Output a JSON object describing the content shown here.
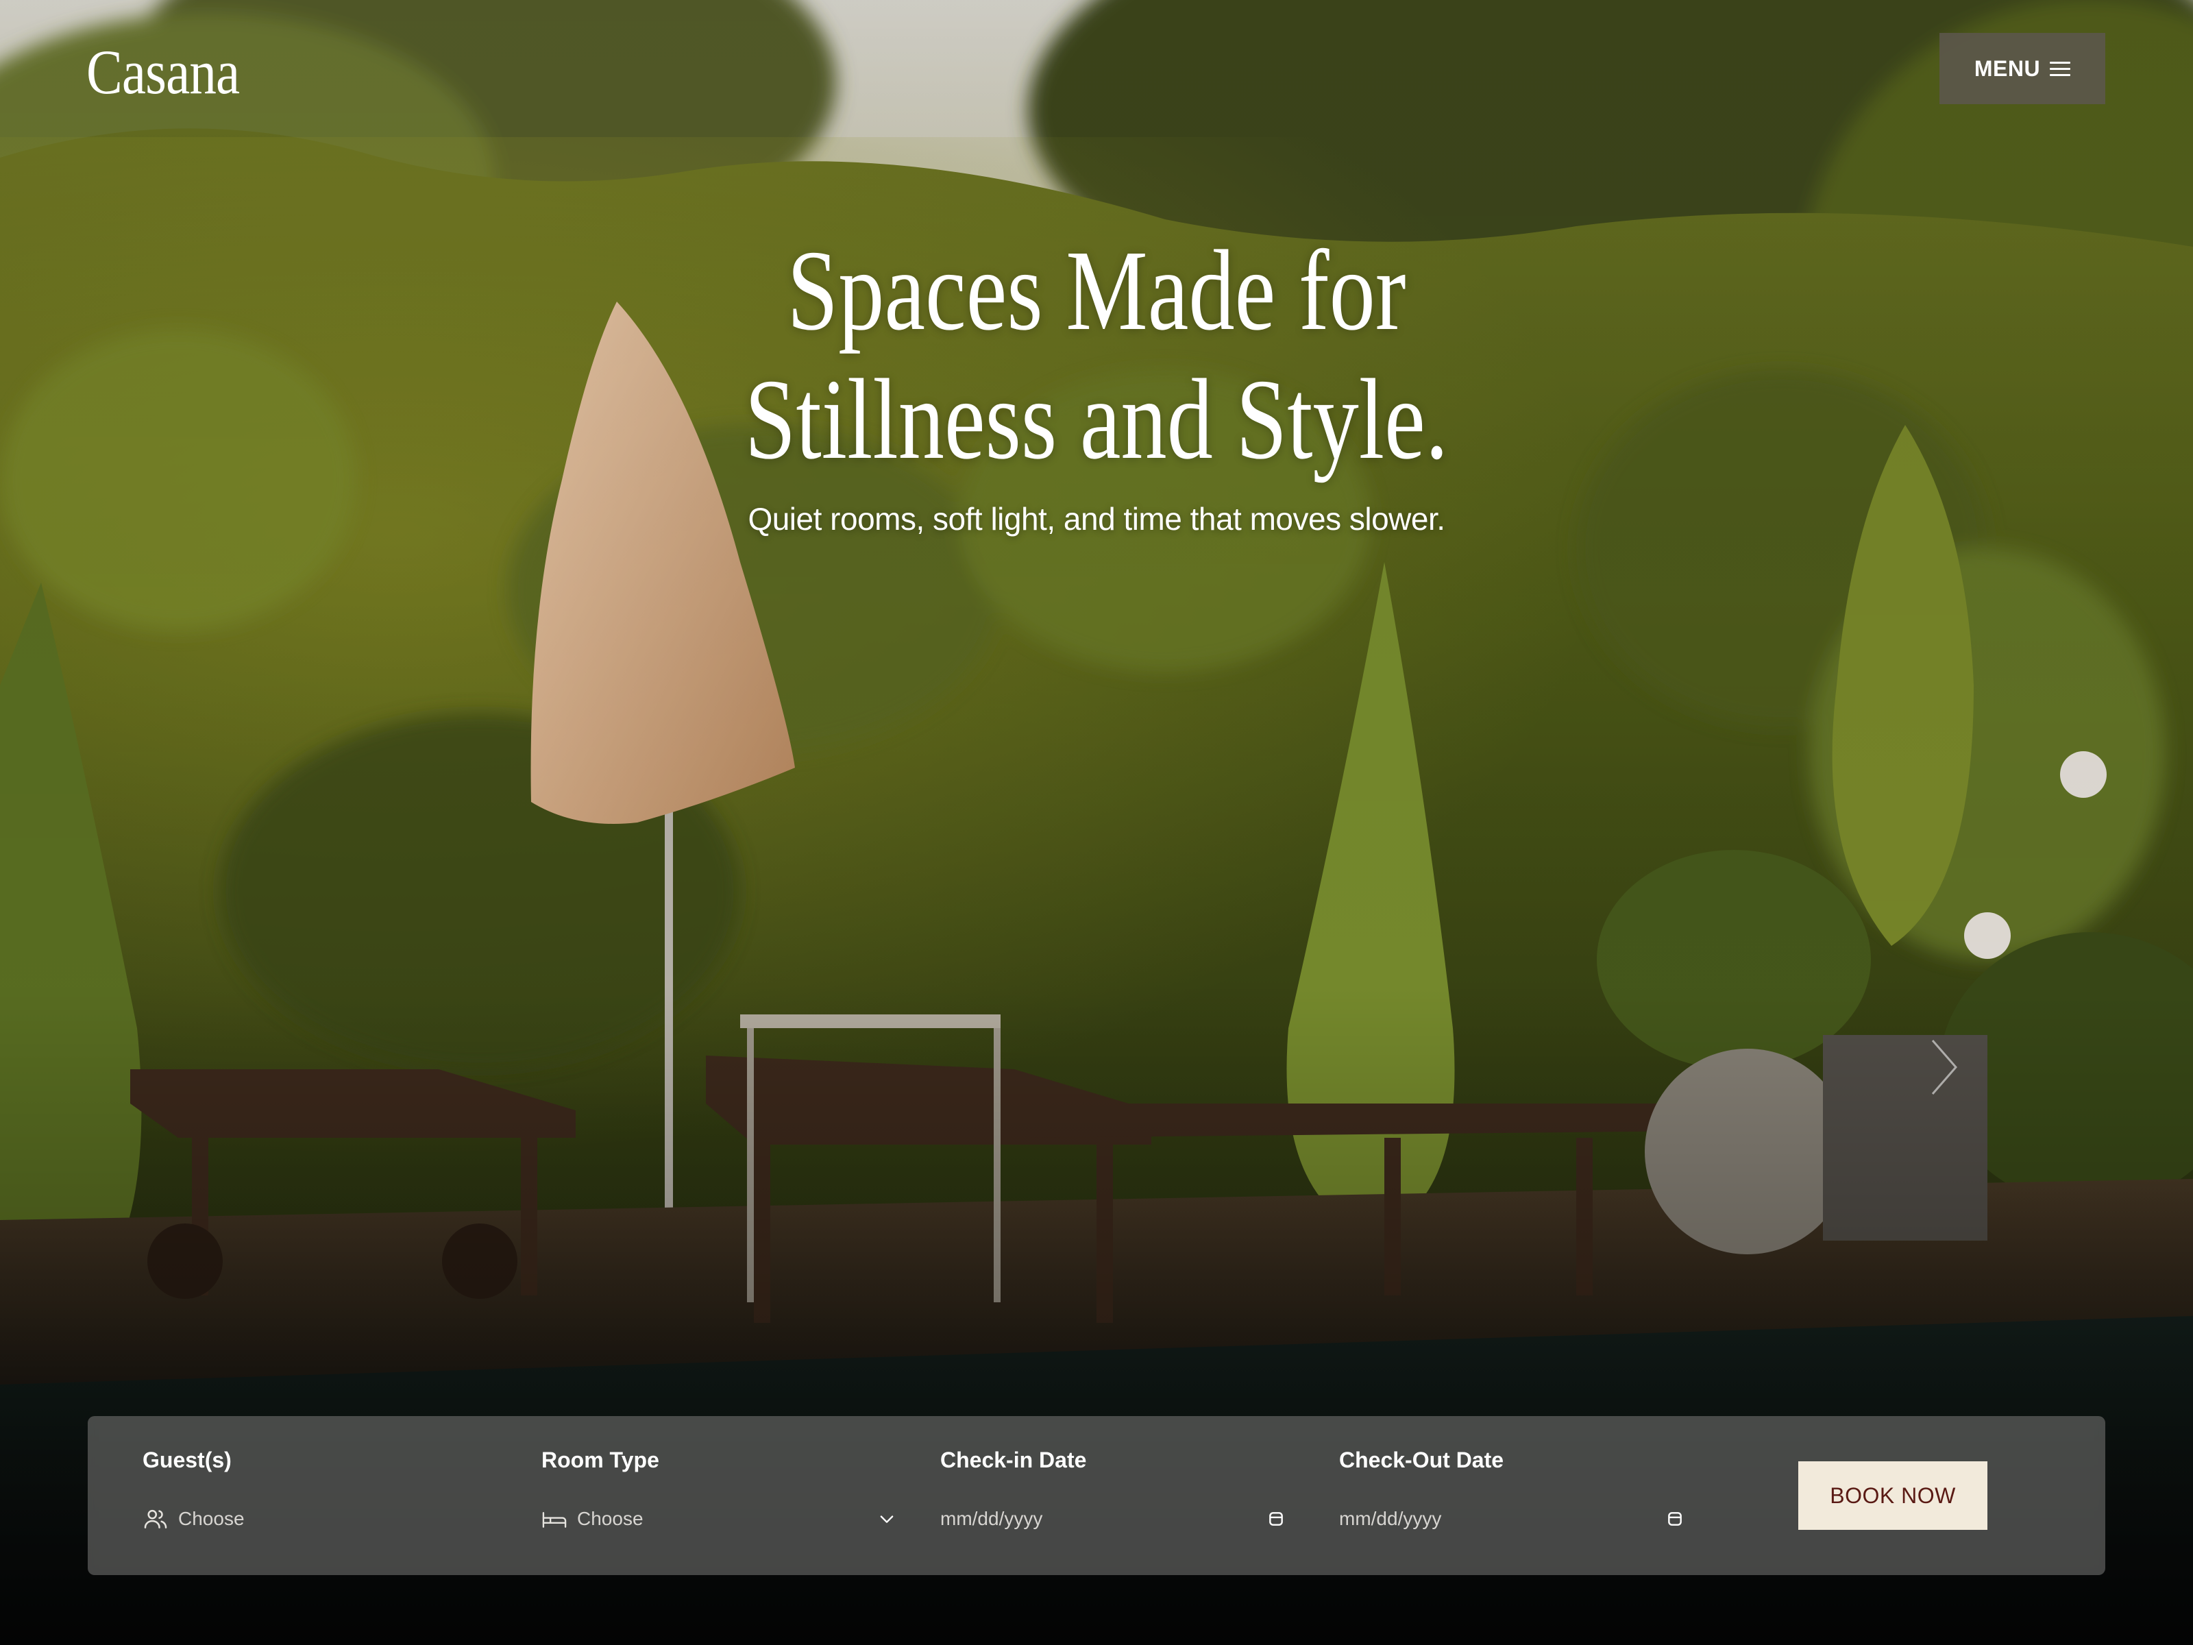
{
  "header": {
    "brand": "Casana",
    "menu_label": "MENU"
  },
  "hero": {
    "title_line1": "Spaces Made for",
    "title_line2": "Stillness and Style.",
    "subtitle": "Quiet rooms, soft light, and time that moves slower."
  },
  "booking": {
    "guests": {
      "label": "Guest(s)",
      "value": "Choose",
      "icon": "users-icon"
    },
    "room_type": {
      "label": "Room Type",
      "value": "Choose",
      "icon": "bed-icon",
      "trail_icon": "chevron-down-icon"
    },
    "check_in": {
      "label": "Check-in Date",
      "placeholder": "mm/dd/yyyy",
      "trail_icon": "calendar-icon"
    },
    "check_out": {
      "label": "Check-Out Date",
      "placeholder": "mm/dd/yyyy",
      "trail_icon": "calendar-icon"
    },
    "book_label": "BOOK NOW"
  },
  "colors": {
    "book_button_bg": "#f2eadb",
    "book_button_text": "#5a1a14",
    "menu_button_bg": "#5c564c",
    "booking_bar_bg": "#6e6e6c"
  }
}
